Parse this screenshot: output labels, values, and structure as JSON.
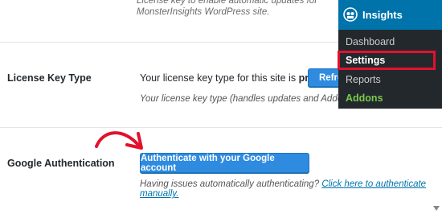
{
  "top_description": "License key to enable automatic updates for MonsterInsights WordPress site.",
  "license_row": {
    "label": "License Key Type",
    "value_prefix": "Your license key type for this site is",
    "value_bold": "pro.",
    "refresh_button": "Refresh",
    "description": "Your license key type (handles updates and Addons)."
  },
  "google_row": {
    "label": "Google Authentication",
    "button": "Authenticate with your Google account",
    "description": "Having issues automatically authenticating?",
    "link": "Click here to authenticate manually."
  },
  "admin_menu": {
    "title": "Insights",
    "items": [
      "Dashboard",
      "Settings",
      "Reports",
      "Addons"
    ],
    "active": "Settings"
  },
  "colors": {
    "accent": "#0073aa",
    "button_blue": "#2e8be0",
    "highlight_red": "#e3112c",
    "addons_green": "#7bc94c",
    "menu_bg": "#23282d"
  },
  "icons": [
    "insights-logo-icon",
    "red-arrow-icon",
    "scroll-down-icon"
  ]
}
